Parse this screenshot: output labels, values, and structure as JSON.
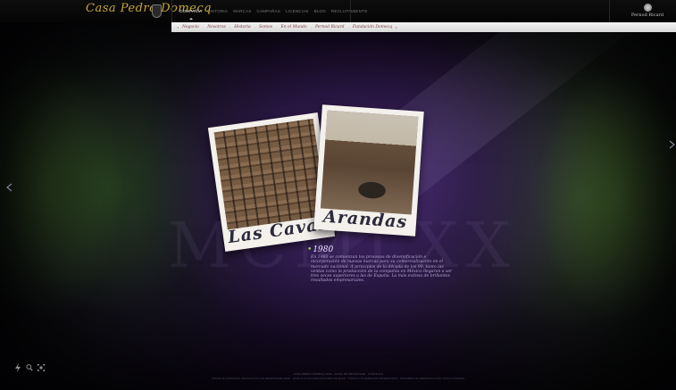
{
  "header": {
    "logo_text": "Casa Pedro Domecq",
    "nav": [
      {
        "label": "Compañía",
        "active": true
      },
      {
        "label": "Historia"
      },
      {
        "label": "Marcas"
      },
      {
        "label": "Campañas"
      },
      {
        "label": "Licencias"
      },
      {
        "label": "Blog"
      },
      {
        "label": "Reclutamiento"
      }
    ],
    "partner": "Pernod Ricard"
  },
  "subnav": {
    "items": [
      "Negocio",
      "Nosotros",
      "Historia",
      "Somos",
      "En el Mundo",
      "Pernod Ricard",
      "Fundación Domecq"
    ]
  },
  "slide": {
    "photos": [
      {
        "caption": "Las Cavas"
      },
      {
        "caption": "Arandas"
      }
    ],
    "ghost_text": "MCMLXX",
    "year": "1980",
    "body": "En 1980 se comienzan los procesos de diversificación e incorporación de nuevas marcas para su comercialización en el mercado nacional. A principios de la década de los 90, tanto las ventas como la producción de la compañía en México llegaron a ser tres veces superiores a las de España. La más exitosa de brillantes resultados empresariales."
  },
  "tools": [
    "lightning-icon",
    "search-icon",
    "fullscreen-icon"
  ],
  "footer": {
    "line1": "CASA PEDRO DOMECQ 2010 · AVISO DE PRIVACIDAD · CONTACTO",
    "line2": "DISFRUTE NUESTROS PRODUCTOS CON RESPONSABILIDAD · ESTE SITIO ES PARA MAYORES DE EDAD · TODOS LOS DERECHOS RESERVADOS · PROHIBIDA SU REPRODUCCIÓN TOTAL O PARCIAL"
  },
  "colors": {
    "accent": "#c9a53a",
    "year_dot": "#8fd36a"
  }
}
